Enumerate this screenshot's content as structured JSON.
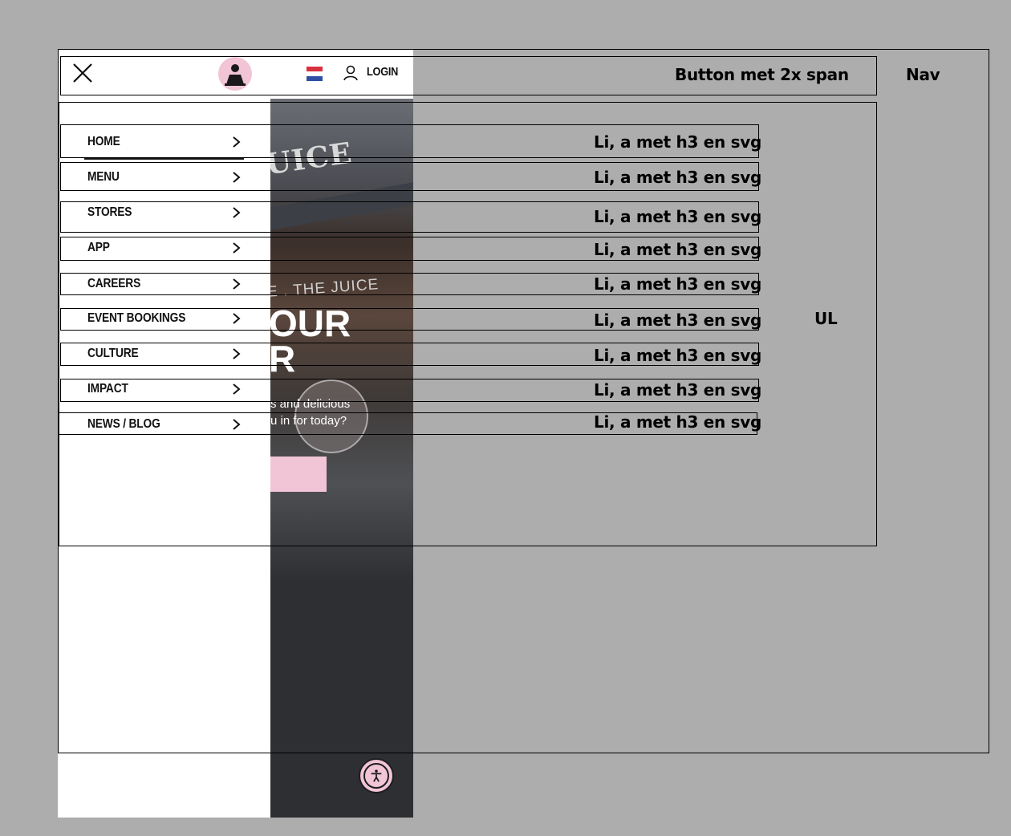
{
  "header": {
    "login_label": "LOGIN"
  },
  "menu": {
    "items": [
      {
        "label": "HOME"
      },
      {
        "label": "MENU"
      },
      {
        "label": "STORES"
      },
      {
        "label": "APP"
      },
      {
        "label": "CAREERS"
      },
      {
        "label": "EVENT BOOKINGS"
      },
      {
        "label": "CULTURE"
      },
      {
        "label": "IMPACT"
      },
      {
        "label": "NEWS / BLOG"
      }
    ]
  },
  "hero": {
    "sign_top": "UICE",
    "sign_awning": "E . THE JUICE",
    "headline_line1": "OUR",
    "headline_line2": "R",
    "sub_line1": "s and delicious",
    "sub_line2": "u in for today?"
  },
  "annotations": {
    "button": "Button met 2x span",
    "nav": "Nav",
    "ul": "UL",
    "li_items": [
      "Li, a met h3 en svg",
      "Li, a met h3 en svg",
      "Li, a met h3 en svg",
      "Li, a met h3 en svg",
      "Li, a met h3 en svg",
      "Li, a met h3 en svg",
      "Li, a met h3 en svg",
      "Li, a met h3 en svg",
      "Li, a met h3 en svg"
    ]
  },
  "colors": {
    "background": "#adadad",
    "brand_pink": "#f1c4d6",
    "hero_dark": "#2e2f33",
    "flag_red": "#d8303f",
    "flag_blue": "#2e4fa3"
  }
}
